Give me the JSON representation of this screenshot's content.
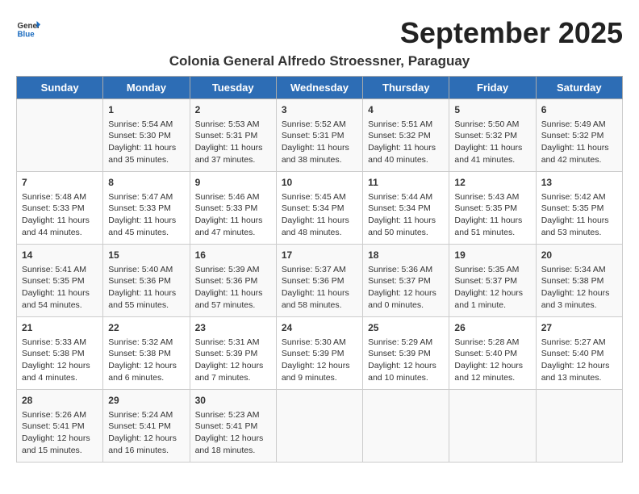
{
  "header": {
    "logo_general": "General",
    "logo_blue": "Blue",
    "month_title": "September 2025",
    "subtitle": "Colonia General Alfredo Stroessner, Paraguay"
  },
  "days_of_week": [
    "Sunday",
    "Monday",
    "Tuesday",
    "Wednesday",
    "Thursday",
    "Friday",
    "Saturday"
  ],
  "weeks": [
    [
      {
        "day": "",
        "sunrise": "",
        "sunset": "",
        "daylight": ""
      },
      {
        "day": "1",
        "sunrise": "Sunrise: 5:54 AM",
        "sunset": "Sunset: 5:30 PM",
        "daylight": "Daylight: 11 hours and 35 minutes."
      },
      {
        "day": "2",
        "sunrise": "Sunrise: 5:53 AM",
        "sunset": "Sunset: 5:31 PM",
        "daylight": "Daylight: 11 hours and 37 minutes."
      },
      {
        "day": "3",
        "sunrise": "Sunrise: 5:52 AM",
        "sunset": "Sunset: 5:31 PM",
        "daylight": "Daylight: 11 hours and 38 minutes."
      },
      {
        "day": "4",
        "sunrise": "Sunrise: 5:51 AM",
        "sunset": "Sunset: 5:32 PM",
        "daylight": "Daylight: 11 hours and 40 minutes."
      },
      {
        "day": "5",
        "sunrise": "Sunrise: 5:50 AM",
        "sunset": "Sunset: 5:32 PM",
        "daylight": "Daylight: 11 hours and 41 minutes."
      },
      {
        "day": "6",
        "sunrise": "Sunrise: 5:49 AM",
        "sunset": "Sunset: 5:32 PM",
        "daylight": "Daylight: 11 hours and 42 minutes."
      }
    ],
    [
      {
        "day": "7",
        "sunrise": "Sunrise: 5:48 AM",
        "sunset": "Sunset: 5:33 PM",
        "daylight": "Daylight: 11 hours and 44 minutes."
      },
      {
        "day": "8",
        "sunrise": "Sunrise: 5:47 AM",
        "sunset": "Sunset: 5:33 PM",
        "daylight": "Daylight: 11 hours and 45 minutes."
      },
      {
        "day": "9",
        "sunrise": "Sunrise: 5:46 AM",
        "sunset": "Sunset: 5:33 PM",
        "daylight": "Daylight: 11 hours and 47 minutes."
      },
      {
        "day": "10",
        "sunrise": "Sunrise: 5:45 AM",
        "sunset": "Sunset: 5:34 PM",
        "daylight": "Daylight: 11 hours and 48 minutes."
      },
      {
        "day": "11",
        "sunrise": "Sunrise: 5:44 AM",
        "sunset": "Sunset: 5:34 PM",
        "daylight": "Daylight: 11 hours and 50 minutes."
      },
      {
        "day": "12",
        "sunrise": "Sunrise: 5:43 AM",
        "sunset": "Sunset: 5:35 PM",
        "daylight": "Daylight: 11 hours and 51 minutes."
      },
      {
        "day": "13",
        "sunrise": "Sunrise: 5:42 AM",
        "sunset": "Sunset: 5:35 PM",
        "daylight": "Daylight: 11 hours and 53 minutes."
      }
    ],
    [
      {
        "day": "14",
        "sunrise": "Sunrise: 5:41 AM",
        "sunset": "Sunset: 5:35 PM",
        "daylight": "Daylight: 11 hours and 54 minutes."
      },
      {
        "day": "15",
        "sunrise": "Sunrise: 5:40 AM",
        "sunset": "Sunset: 5:36 PM",
        "daylight": "Daylight: 11 hours and 55 minutes."
      },
      {
        "day": "16",
        "sunrise": "Sunrise: 5:39 AM",
        "sunset": "Sunset: 5:36 PM",
        "daylight": "Daylight: 11 hours and 57 minutes."
      },
      {
        "day": "17",
        "sunrise": "Sunrise: 5:37 AM",
        "sunset": "Sunset: 5:36 PM",
        "daylight": "Daylight: 11 hours and 58 minutes."
      },
      {
        "day": "18",
        "sunrise": "Sunrise: 5:36 AM",
        "sunset": "Sunset: 5:37 PM",
        "daylight": "Daylight: 12 hours and 0 minutes."
      },
      {
        "day": "19",
        "sunrise": "Sunrise: 5:35 AM",
        "sunset": "Sunset: 5:37 PM",
        "daylight": "Daylight: 12 hours and 1 minute."
      },
      {
        "day": "20",
        "sunrise": "Sunrise: 5:34 AM",
        "sunset": "Sunset: 5:38 PM",
        "daylight": "Daylight: 12 hours and 3 minutes."
      }
    ],
    [
      {
        "day": "21",
        "sunrise": "Sunrise: 5:33 AM",
        "sunset": "Sunset: 5:38 PM",
        "daylight": "Daylight: 12 hours and 4 minutes."
      },
      {
        "day": "22",
        "sunrise": "Sunrise: 5:32 AM",
        "sunset": "Sunset: 5:38 PM",
        "daylight": "Daylight: 12 hours and 6 minutes."
      },
      {
        "day": "23",
        "sunrise": "Sunrise: 5:31 AM",
        "sunset": "Sunset: 5:39 PM",
        "daylight": "Daylight: 12 hours and 7 minutes."
      },
      {
        "day": "24",
        "sunrise": "Sunrise: 5:30 AM",
        "sunset": "Sunset: 5:39 PM",
        "daylight": "Daylight: 12 hours and 9 minutes."
      },
      {
        "day": "25",
        "sunrise": "Sunrise: 5:29 AM",
        "sunset": "Sunset: 5:39 PM",
        "daylight": "Daylight: 12 hours and 10 minutes."
      },
      {
        "day": "26",
        "sunrise": "Sunrise: 5:28 AM",
        "sunset": "Sunset: 5:40 PM",
        "daylight": "Daylight: 12 hours and 12 minutes."
      },
      {
        "day": "27",
        "sunrise": "Sunrise: 5:27 AM",
        "sunset": "Sunset: 5:40 PM",
        "daylight": "Daylight: 12 hours and 13 minutes."
      }
    ],
    [
      {
        "day": "28",
        "sunrise": "Sunrise: 5:26 AM",
        "sunset": "Sunset: 5:41 PM",
        "daylight": "Daylight: 12 hours and 15 minutes."
      },
      {
        "day": "29",
        "sunrise": "Sunrise: 5:24 AM",
        "sunset": "Sunset: 5:41 PM",
        "daylight": "Daylight: 12 hours and 16 minutes."
      },
      {
        "day": "30",
        "sunrise": "Sunrise: 5:23 AM",
        "sunset": "Sunset: 5:41 PM",
        "daylight": "Daylight: 12 hours and 18 minutes."
      },
      {
        "day": "",
        "sunrise": "",
        "sunset": "",
        "daylight": ""
      },
      {
        "day": "",
        "sunrise": "",
        "sunset": "",
        "daylight": ""
      },
      {
        "day": "",
        "sunrise": "",
        "sunset": "",
        "daylight": ""
      },
      {
        "day": "",
        "sunrise": "",
        "sunset": "",
        "daylight": ""
      }
    ]
  ]
}
